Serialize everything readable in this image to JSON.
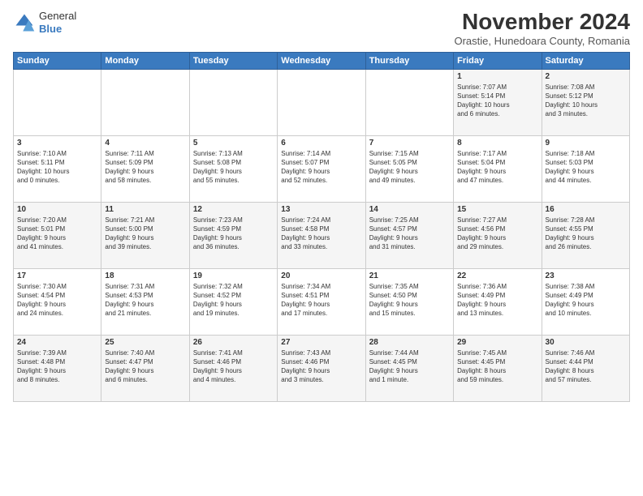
{
  "logo": {
    "general": "General",
    "blue": "Blue"
  },
  "title": "November 2024",
  "subtitle": "Orastie, Hunedoara County, Romania",
  "headers": [
    "Sunday",
    "Monday",
    "Tuesday",
    "Wednesday",
    "Thursday",
    "Friday",
    "Saturday"
  ],
  "weeks": [
    [
      {
        "day": "",
        "info": ""
      },
      {
        "day": "",
        "info": ""
      },
      {
        "day": "",
        "info": ""
      },
      {
        "day": "",
        "info": ""
      },
      {
        "day": "",
        "info": ""
      },
      {
        "day": "1",
        "info": "Sunrise: 7:07 AM\nSunset: 5:14 PM\nDaylight: 10 hours\nand 6 minutes."
      },
      {
        "day": "2",
        "info": "Sunrise: 7:08 AM\nSunset: 5:12 PM\nDaylight: 10 hours\nand 3 minutes."
      }
    ],
    [
      {
        "day": "3",
        "info": "Sunrise: 7:10 AM\nSunset: 5:11 PM\nDaylight: 10 hours\nand 0 minutes."
      },
      {
        "day": "4",
        "info": "Sunrise: 7:11 AM\nSunset: 5:09 PM\nDaylight: 9 hours\nand 58 minutes."
      },
      {
        "day": "5",
        "info": "Sunrise: 7:13 AM\nSunset: 5:08 PM\nDaylight: 9 hours\nand 55 minutes."
      },
      {
        "day": "6",
        "info": "Sunrise: 7:14 AM\nSunset: 5:07 PM\nDaylight: 9 hours\nand 52 minutes."
      },
      {
        "day": "7",
        "info": "Sunrise: 7:15 AM\nSunset: 5:05 PM\nDaylight: 9 hours\nand 49 minutes."
      },
      {
        "day": "8",
        "info": "Sunrise: 7:17 AM\nSunset: 5:04 PM\nDaylight: 9 hours\nand 47 minutes."
      },
      {
        "day": "9",
        "info": "Sunrise: 7:18 AM\nSunset: 5:03 PM\nDaylight: 9 hours\nand 44 minutes."
      }
    ],
    [
      {
        "day": "10",
        "info": "Sunrise: 7:20 AM\nSunset: 5:01 PM\nDaylight: 9 hours\nand 41 minutes."
      },
      {
        "day": "11",
        "info": "Sunrise: 7:21 AM\nSunset: 5:00 PM\nDaylight: 9 hours\nand 39 minutes."
      },
      {
        "day": "12",
        "info": "Sunrise: 7:23 AM\nSunset: 4:59 PM\nDaylight: 9 hours\nand 36 minutes."
      },
      {
        "day": "13",
        "info": "Sunrise: 7:24 AM\nSunset: 4:58 PM\nDaylight: 9 hours\nand 33 minutes."
      },
      {
        "day": "14",
        "info": "Sunrise: 7:25 AM\nSunset: 4:57 PM\nDaylight: 9 hours\nand 31 minutes."
      },
      {
        "day": "15",
        "info": "Sunrise: 7:27 AM\nSunset: 4:56 PM\nDaylight: 9 hours\nand 29 minutes."
      },
      {
        "day": "16",
        "info": "Sunrise: 7:28 AM\nSunset: 4:55 PM\nDaylight: 9 hours\nand 26 minutes."
      }
    ],
    [
      {
        "day": "17",
        "info": "Sunrise: 7:30 AM\nSunset: 4:54 PM\nDaylight: 9 hours\nand 24 minutes."
      },
      {
        "day": "18",
        "info": "Sunrise: 7:31 AM\nSunset: 4:53 PM\nDaylight: 9 hours\nand 21 minutes."
      },
      {
        "day": "19",
        "info": "Sunrise: 7:32 AM\nSunset: 4:52 PM\nDaylight: 9 hours\nand 19 minutes."
      },
      {
        "day": "20",
        "info": "Sunrise: 7:34 AM\nSunset: 4:51 PM\nDaylight: 9 hours\nand 17 minutes."
      },
      {
        "day": "21",
        "info": "Sunrise: 7:35 AM\nSunset: 4:50 PM\nDaylight: 9 hours\nand 15 minutes."
      },
      {
        "day": "22",
        "info": "Sunrise: 7:36 AM\nSunset: 4:49 PM\nDaylight: 9 hours\nand 13 minutes."
      },
      {
        "day": "23",
        "info": "Sunrise: 7:38 AM\nSunset: 4:49 PM\nDaylight: 9 hours\nand 10 minutes."
      }
    ],
    [
      {
        "day": "24",
        "info": "Sunrise: 7:39 AM\nSunset: 4:48 PM\nDaylight: 9 hours\nand 8 minutes."
      },
      {
        "day": "25",
        "info": "Sunrise: 7:40 AM\nSunset: 4:47 PM\nDaylight: 9 hours\nand 6 minutes."
      },
      {
        "day": "26",
        "info": "Sunrise: 7:41 AM\nSunset: 4:46 PM\nDaylight: 9 hours\nand 4 minutes."
      },
      {
        "day": "27",
        "info": "Sunrise: 7:43 AM\nSunset: 4:46 PM\nDaylight: 9 hours\nand 3 minutes."
      },
      {
        "day": "28",
        "info": "Sunrise: 7:44 AM\nSunset: 4:45 PM\nDaylight: 9 hours\nand 1 minute."
      },
      {
        "day": "29",
        "info": "Sunrise: 7:45 AM\nSunset: 4:45 PM\nDaylight: 8 hours\nand 59 minutes."
      },
      {
        "day": "30",
        "info": "Sunrise: 7:46 AM\nSunset: 4:44 PM\nDaylight: 8 hours\nand 57 minutes."
      }
    ]
  ]
}
